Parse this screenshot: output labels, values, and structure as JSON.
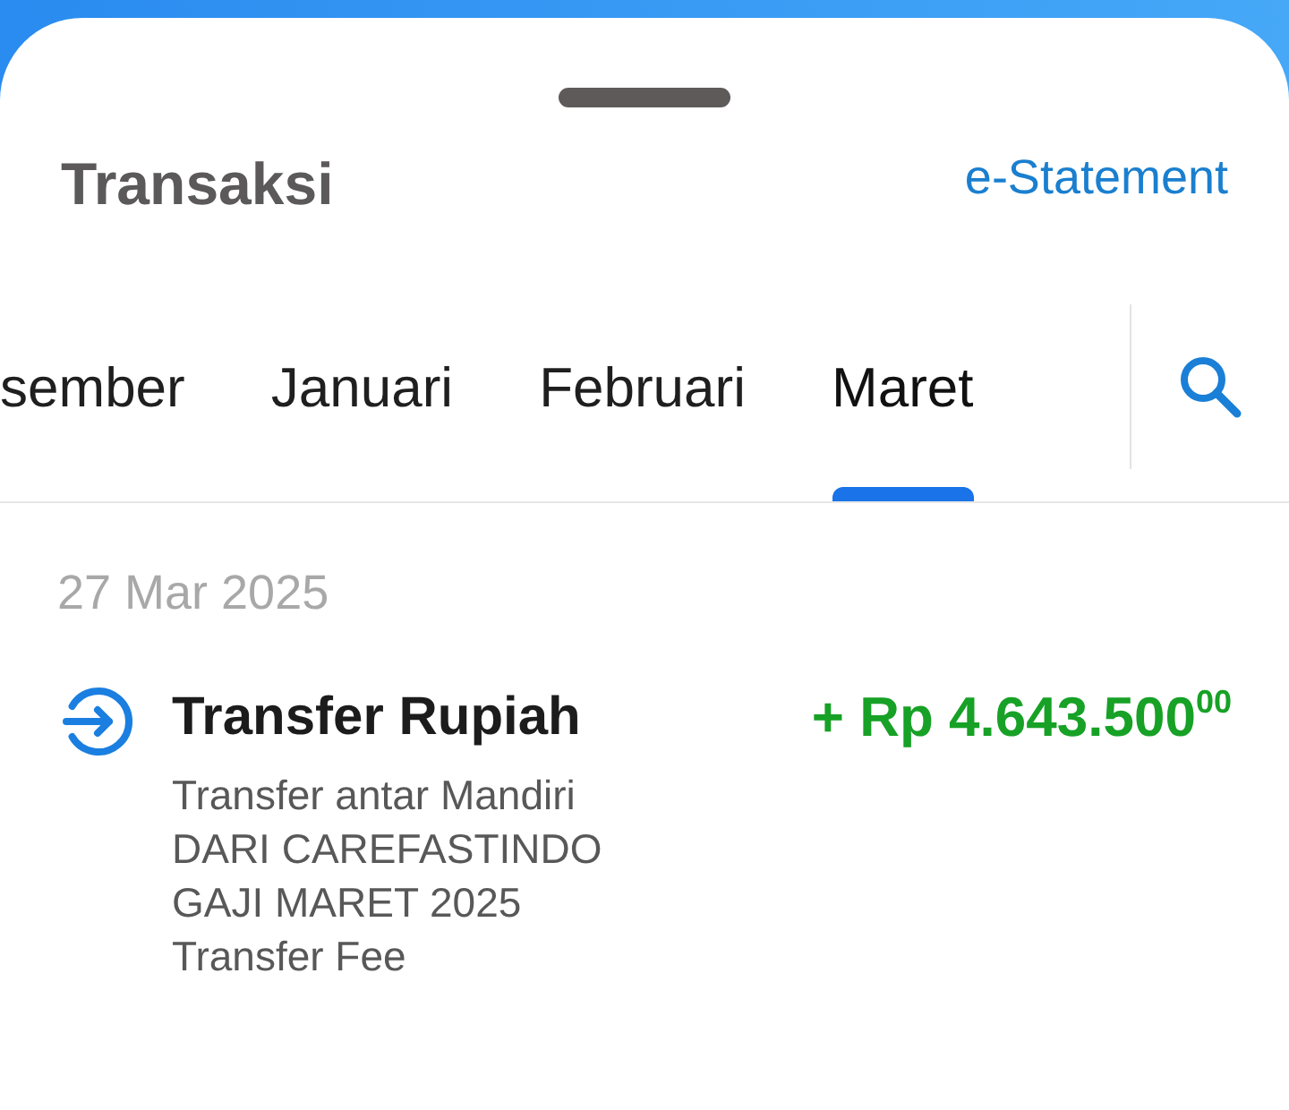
{
  "header": {
    "title": "Transaksi",
    "link": "e-Statement"
  },
  "tabs": [
    {
      "label": "sember",
      "selected": false
    },
    {
      "label": "Januari",
      "selected": false
    },
    {
      "label": "Februari",
      "selected": false
    },
    {
      "label": "Maret",
      "selected": true
    }
  ],
  "groups": [
    {
      "date": "27 Mar 2025",
      "transactions": [
        {
          "kind": "incoming",
          "title": "Transfer Rupiah",
          "amount": "+ Rp 4.643.500$^{00}$",
          "details": [
            "Transfer antar Mandiri",
            "DARI CAREFASTINDO",
            "GAJI MARET 2025",
            "Transfer Fee"
          ]
        }
      ]
    }
  ]
}
